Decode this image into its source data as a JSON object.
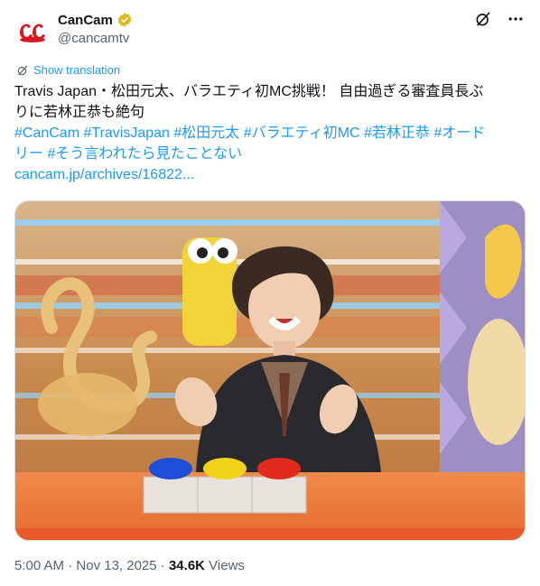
{
  "account": {
    "display_name": "CanCam",
    "handle": "@cancamtv",
    "avatar_text": "CanCam",
    "verified_color": "#e2b719"
  },
  "actions": {
    "grok_icon": "grok-icon",
    "more_icon": "more-icon"
  },
  "translation": {
    "label": "Show translation"
  },
  "tweet": {
    "line1": "Travis Japan・松田元太、バラエティ初MC挑戦！ 自由過ぎる審査員長ぶ",
    "line2": "りに若林正恭も絶句",
    "hashtags_line1": [
      "#CanCam",
      "#TravisJapan",
      "#松田元太",
      "#バラエティ初MC",
      "#若林正恭",
      "#オード"
    ],
    "hashtags_line2": [
      "リー",
      "#そう言われたら見たことない"
    ],
    "link": "cancam.jp/archives/16822..."
  },
  "meta": {
    "time": "5:00 AM",
    "date": "Nov 13, 2025",
    "views_count": "34.6K",
    "views_label": "Views"
  },
  "colors": {
    "link": "#1d9bf0",
    "text": "#0f1419",
    "muted": "#536471",
    "brand_red": "#d7191f"
  }
}
